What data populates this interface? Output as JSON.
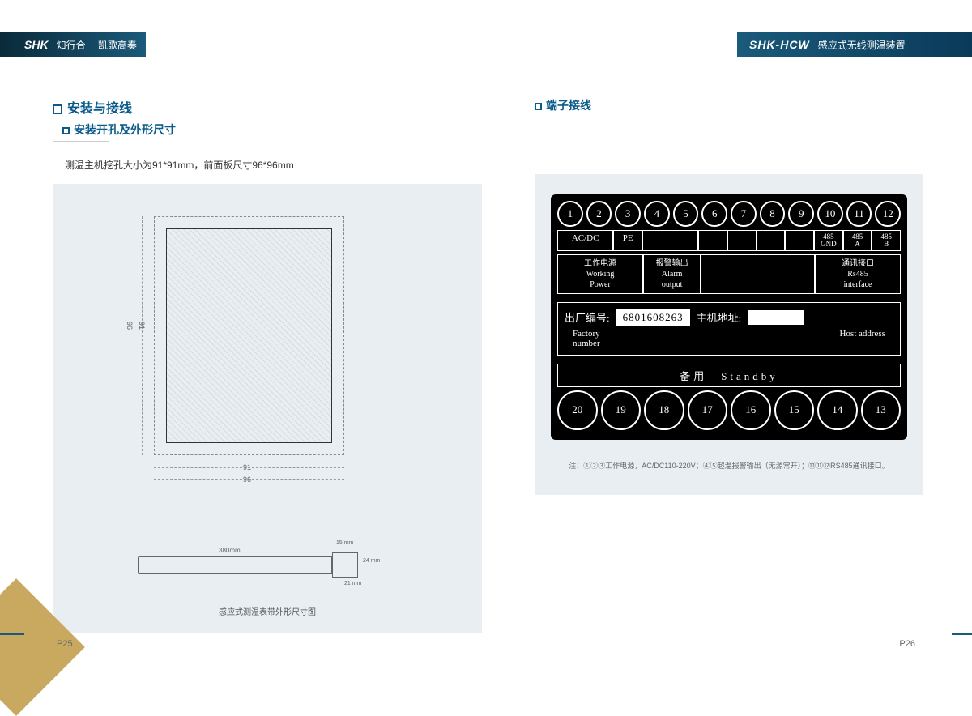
{
  "header": {
    "logo": "SHK",
    "slogan": "知行合一 凯歌高奏",
    "product": "SHK-HCW",
    "product_name": "感应式无线测温装置"
  },
  "left": {
    "h1": "安装与接线",
    "h2": "安装开孔及外形尺寸",
    "desc": "测温主机挖孔大小为91*91mm，前面板尺寸96*96mm",
    "dim_96": "96",
    "dim_91": "91",
    "dim_91b": "91",
    "dim_96b": "96",
    "strap_380": "380mm",
    "strap_15": "15 mm",
    "strap_24": "24 mm",
    "strap_21": "21 mm",
    "strap_caption": "感应式测温表带外形尺寸图"
  },
  "right": {
    "h2": "端子接线",
    "top_nums": [
      "1",
      "2",
      "3",
      "4",
      "5",
      "6",
      "7",
      "8",
      "9",
      "10",
      "11",
      "12"
    ],
    "labels": {
      "acdc": "AC/DC",
      "pe": "PE",
      "gnd": "485\nGND",
      "a": "485\nA",
      "b": "485\nB"
    },
    "desc": {
      "power_cn": "工作电源",
      "power_en": "Working\nPower",
      "alarm_cn": "报警输出",
      "alarm_en": "Alarm\noutput",
      "comm_cn": "通讯接口",
      "comm_en": "Rs485\ninterface"
    },
    "factory_label": "出厂编号:",
    "factory_num": "6801608263",
    "host_label": "主机地址:",
    "factory_en": "Factory\nnumber",
    "host_en": "Host address",
    "standby": "备用　Standby",
    "bot_nums": [
      "20",
      "19",
      "18",
      "17",
      "16",
      "15",
      "14",
      "13"
    ],
    "note": "注：①②③工作电源，AC/DC110-220V；④⑤超温报警输出（无源常开）；⑩⑪⑫RS485通讯接口。"
  },
  "footer": {
    "p_left": "P25",
    "p_right": "P26"
  }
}
